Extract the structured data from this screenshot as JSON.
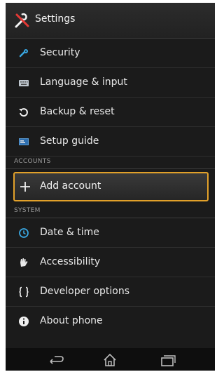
{
  "header": {
    "title": "Settings",
    "icon": "tools-icon"
  },
  "items_top": [
    {
      "label": "Security",
      "icon": "security-icon"
    },
    {
      "label": "Language & input",
      "icon": "keyboard-icon"
    },
    {
      "label": "Backup & reset",
      "icon": "backup-icon"
    },
    {
      "label": "Setup guide",
      "icon": "setup-guide-icon"
    }
  ],
  "sections": {
    "accounts": "ACCOUNTS",
    "system": "SYSTEM"
  },
  "add_account": {
    "label": "Add account",
    "icon": "plus-icon",
    "highlight_color": "#e2a12a"
  },
  "items_system": [
    {
      "label": "Date & time",
      "icon": "clock-icon"
    },
    {
      "label": "Accessibility",
      "icon": "hand-icon"
    },
    {
      "label": "Developer options",
      "icon": "braces-icon"
    },
    {
      "label": "About phone",
      "icon": "info-icon"
    }
  ],
  "navbar": {
    "buttons": [
      "back-icon",
      "home-icon",
      "recent-apps-icon"
    ]
  },
  "colors": {
    "background": "#1b1b1b",
    "accent_blue": "#39a6e0"
  }
}
